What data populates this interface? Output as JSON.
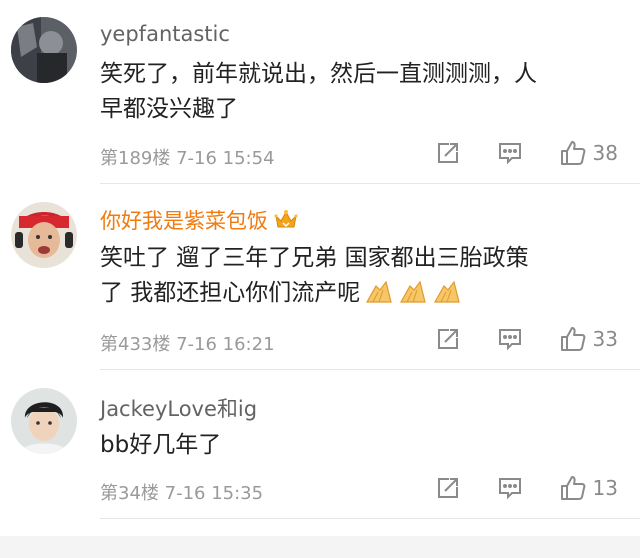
{
  "comments": [
    {
      "username": "yepfantastic",
      "text_lines": [
        "笑死了，前年就说出，然后一直测测测，人",
        "早都没兴趣了"
      ],
      "floor_time": "第189楼 7-16 15:54",
      "likes": "38",
      "icons": [
        "repost-icon",
        "reply-icon",
        "thumbs-up-icon"
      ]
    },
    {
      "username": "你好我是紫菜包饭",
      "vip_badge": "crown-icon",
      "text_lines": [
        "笑吐了 遛了三年了兄弟 国家都出三胎政策",
        "了 我都还担心你们流产呢"
      ],
      "emojis": [
        "clap-icon",
        "clap-icon",
        "clap-icon"
      ],
      "floor_time": "第433楼 7-16 16:21",
      "likes": "33"
    },
    {
      "username": "JackeyLove和ig",
      "text_lines": [
        "bb好几年了"
      ],
      "floor_time": "第34楼 7-16 15:35",
      "likes": "13"
    }
  ],
  "colors": {
    "username": "#636363",
    "vip_username": "#f07b10",
    "meta": "#9a9a9a",
    "text": "#222222"
  }
}
